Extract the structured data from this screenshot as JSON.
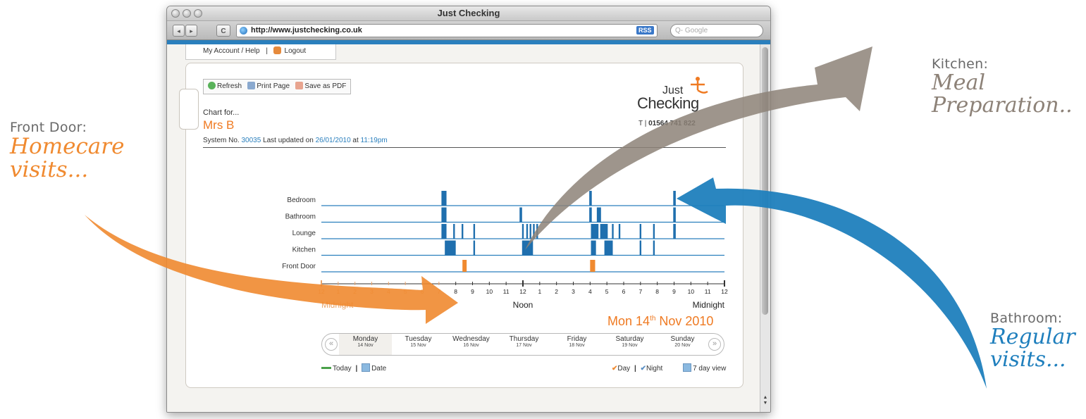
{
  "annotations": {
    "front_door": {
      "heading": "Front Door:",
      "line1": "Homecare",
      "line2": "visits..."
    },
    "kitchen": {
      "heading": "Kitchen:",
      "line1": "Meal",
      "line2": "Preparation.."
    },
    "bathroom": {
      "heading": "Bathroom:",
      "line1": "Regular",
      "line2": "visits..."
    }
  },
  "browser": {
    "title": "Just Checking",
    "url": "http://www.justchecking.co.uk",
    "rss": "RSS",
    "search_placeholder": "Q- Google",
    "back": "◂",
    "forward": "▸",
    "reload": "C"
  },
  "account": {
    "help": "My Account / Help",
    "sep": "|",
    "logout": "Logout"
  },
  "actions": {
    "refresh": "Refresh",
    "print": "Print Page",
    "pdf": "Save as PDF"
  },
  "header": {
    "chart_for": "Chart for...",
    "person": "Mrs B",
    "system_prefix": "System No.",
    "system_no": "30035",
    "updated_prefix": "Last updated on",
    "updated_date": "26/01/2010",
    "at": "at",
    "updated_time": "11:19pm"
  },
  "logo": {
    "just": "Just",
    "checking": "Checking",
    "phone_prefix": "T |",
    "phone": "01564 741 822"
  },
  "chart_data": {
    "type": "timeline",
    "rows": [
      "Bedroom",
      "Bathroom",
      "Lounge",
      "Kitchen",
      "Front Door"
    ],
    "x_range_hours": [
      0,
      24
    ],
    "tick_labels": [
      "12",
      "1",
      "2",
      "3",
      "4",
      "5",
      "6",
      "7",
      "8",
      "9",
      "10",
      "11",
      "12",
      "1",
      "2",
      "3",
      "4",
      "5",
      "6",
      "7",
      "8",
      "9",
      "10",
      "11",
      "12"
    ],
    "axis_labels": {
      "left": "Midnight",
      "center": "Noon",
      "right": "Midnight"
    },
    "colors": {
      "activity": "#1f6fae",
      "front_door": "#f08a30",
      "pre_morning_tick": "#e9a46a"
    },
    "events": [
      {
        "row": "Bedroom",
        "start": 7.15,
        "end": 7.45
      },
      {
        "row": "Bedroom",
        "start": 15.95,
        "end": 16.1
      },
      {
        "row": "Bedroom",
        "start": 20.95,
        "end": 21.1
      },
      {
        "row": "Bathroom",
        "start": 7.15,
        "end": 7.45
      },
      {
        "row": "Bathroom",
        "start": 11.8,
        "end": 11.95
      },
      {
        "row": "Bathroom",
        "start": 15.95,
        "end": 16.1
      },
      {
        "row": "Bathroom",
        "start": 16.4,
        "end": 16.65
      },
      {
        "row": "Bathroom",
        "start": 20.95,
        "end": 21.1
      },
      {
        "row": "Lounge",
        "start": 7.15,
        "end": 7.45
      },
      {
        "row": "Lounge",
        "start": 7.85,
        "end": 7.95
      },
      {
        "row": "Lounge",
        "start": 8.35,
        "end": 8.45
      },
      {
        "row": "Lounge",
        "start": 9.05,
        "end": 9.15
      },
      {
        "row": "Lounge",
        "start": 11.95,
        "end": 12.05
      },
      {
        "row": "Lounge",
        "start": 12.2,
        "end": 12.3
      },
      {
        "row": "Lounge",
        "start": 12.4,
        "end": 12.5
      },
      {
        "row": "Lounge",
        "start": 12.6,
        "end": 12.7
      },
      {
        "row": "Lounge",
        "start": 12.8,
        "end": 12.9
      },
      {
        "row": "Lounge",
        "start": 16.05,
        "end": 16.5
      },
      {
        "row": "Lounge",
        "start": 16.6,
        "end": 17.05
      },
      {
        "row": "Lounge",
        "start": 17.3,
        "end": 17.4
      },
      {
        "row": "Lounge",
        "start": 17.7,
        "end": 17.8
      },
      {
        "row": "Lounge",
        "start": 18.95,
        "end": 19.05
      },
      {
        "row": "Lounge",
        "start": 19.75,
        "end": 19.85
      },
      {
        "row": "Lounge",
        "start": 20.95,
        "end": 21.1
      },
      {
        "row": "Kitchen",
        "start": 7.35,
        "end": 8.0
      },
      {
        "row": "Kitchen",
        "start": 9.05,
        "end": 9.15
      },
      {
        "row": "Kitchen",
        "start": 11.95,
        "end": 12.6
      },
      {
        "row": "Kitchen",
        "start": 16.05,
        "end": 16.35
      },
      {
        "row": "Kitchen",
        "start": 16.85,
        "end": 17.35
      },
      {
        "row": "Kitchen",
        "start": 18.95,
        "end": 19.05
      },
      {
        "row": "Kitchen",
        "start": 19.75,
        "end": 19.85
      },
      {
        "row": "Front Door",
        "start": 8.4,
        "end": 8.65
      },
      {
        "row": "Front Door",
        "start": 16.0,
        "end": 16.3
      }
    ]
  },
  "date_title": {
    "prefix": "Mon 14",
    "sup": "th",
    "suffix": " Nov 2010"
  },
  "week": [
    {
      "day": "Monday",
      "date": "14 Nov"
    },
    {
      "day": "Tuesday",
      "date": "15 Nov"
    },
    {
      "day": "Wednesday",
      "date": "16 Nov"
    },
    {
      "day": "Thursday",
      "date": "17 Nov"
    },
    {
      "day": "Friday",
      "date": "18 Nov"
    },
    {
      "day": "Saturday",
      "date": "19 Nov"
    },
    {
      "day": "Sunday",
      "date": "20 Nov"
    }
  ],
  "week_nav": {
    "prev": "«",
    "next": "»"
  },
  "footer": {
    "today": "Today",
    "sep": "|",
    "date": "Date",
    "day": "Day",
    "night": "Night",
    "seven_day": "7 day view"
  }
}
